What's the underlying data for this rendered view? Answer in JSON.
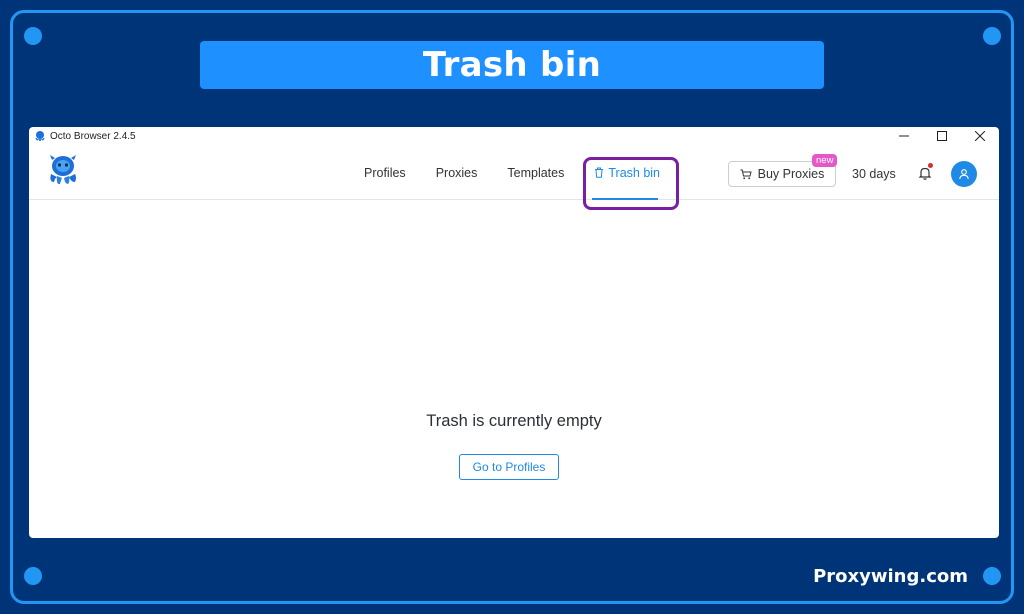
{
  "banner": {
    "title": "Trash bin"
  },
  "watermark": {
    "text": "Proxywing.com"
  },
  "window": {
    "title": "Octo Browser 2.4.5",
    "controls": {
      "minimize": "—",
      "maximize": "☐",
      "close": "✕"
    }
  },
  "nav": {
    "tabs": [
      {
        "label": "Profiles"
      },
      {
        "label": "Proxies"
      },
      {
        "label": "Templates"
      },
      {
        "label": "Trash bin",
        "icon": "trash-icon",
        "active": true
      }
    ],
    "buy_proxies": {
      "label": "Buy Proxies",
      "badge": "new"
    },
    "subscription_days": "30 days"
  },
  "main": {
    "empty_message": "Trash is currently empty",
    "go_button": "Go to Profiles"
  },
  "colors": {
    "background": "#003478",
    "accent": "#1e8ae6",
    "banner": "#1e90ff",
    "highlight": "#7b1fa2",
    "badge": "#e458c8"
  }
}
